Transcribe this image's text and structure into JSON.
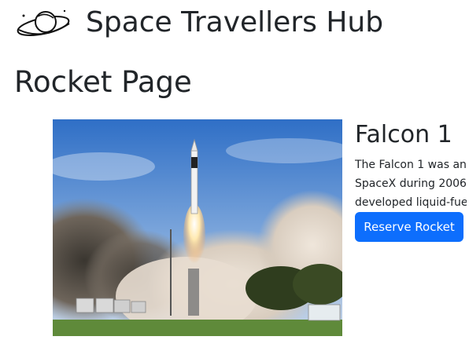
{
  "header": {
    "logo_icon": "planet-logo-icon",
    "brand": "Space Travellers Hub"
  },
  "page": {
    "title": "Rocket Page"
  },
  "rocket": {
    "name": "Falcon 1",
    "description_lines": [
      "The Falcon 1 was an",
      "SpaceX during 2006-",
      "developed liquid-fue"
    ],
    "reserve_label": "Reserve Rocket",
    "image_icon": "rocket-launch-photo"
  },
  "colors": {
    "button": "#0d6efd",
    "button_text": "#ffffff",
    "text": "#212529"
  }
}
